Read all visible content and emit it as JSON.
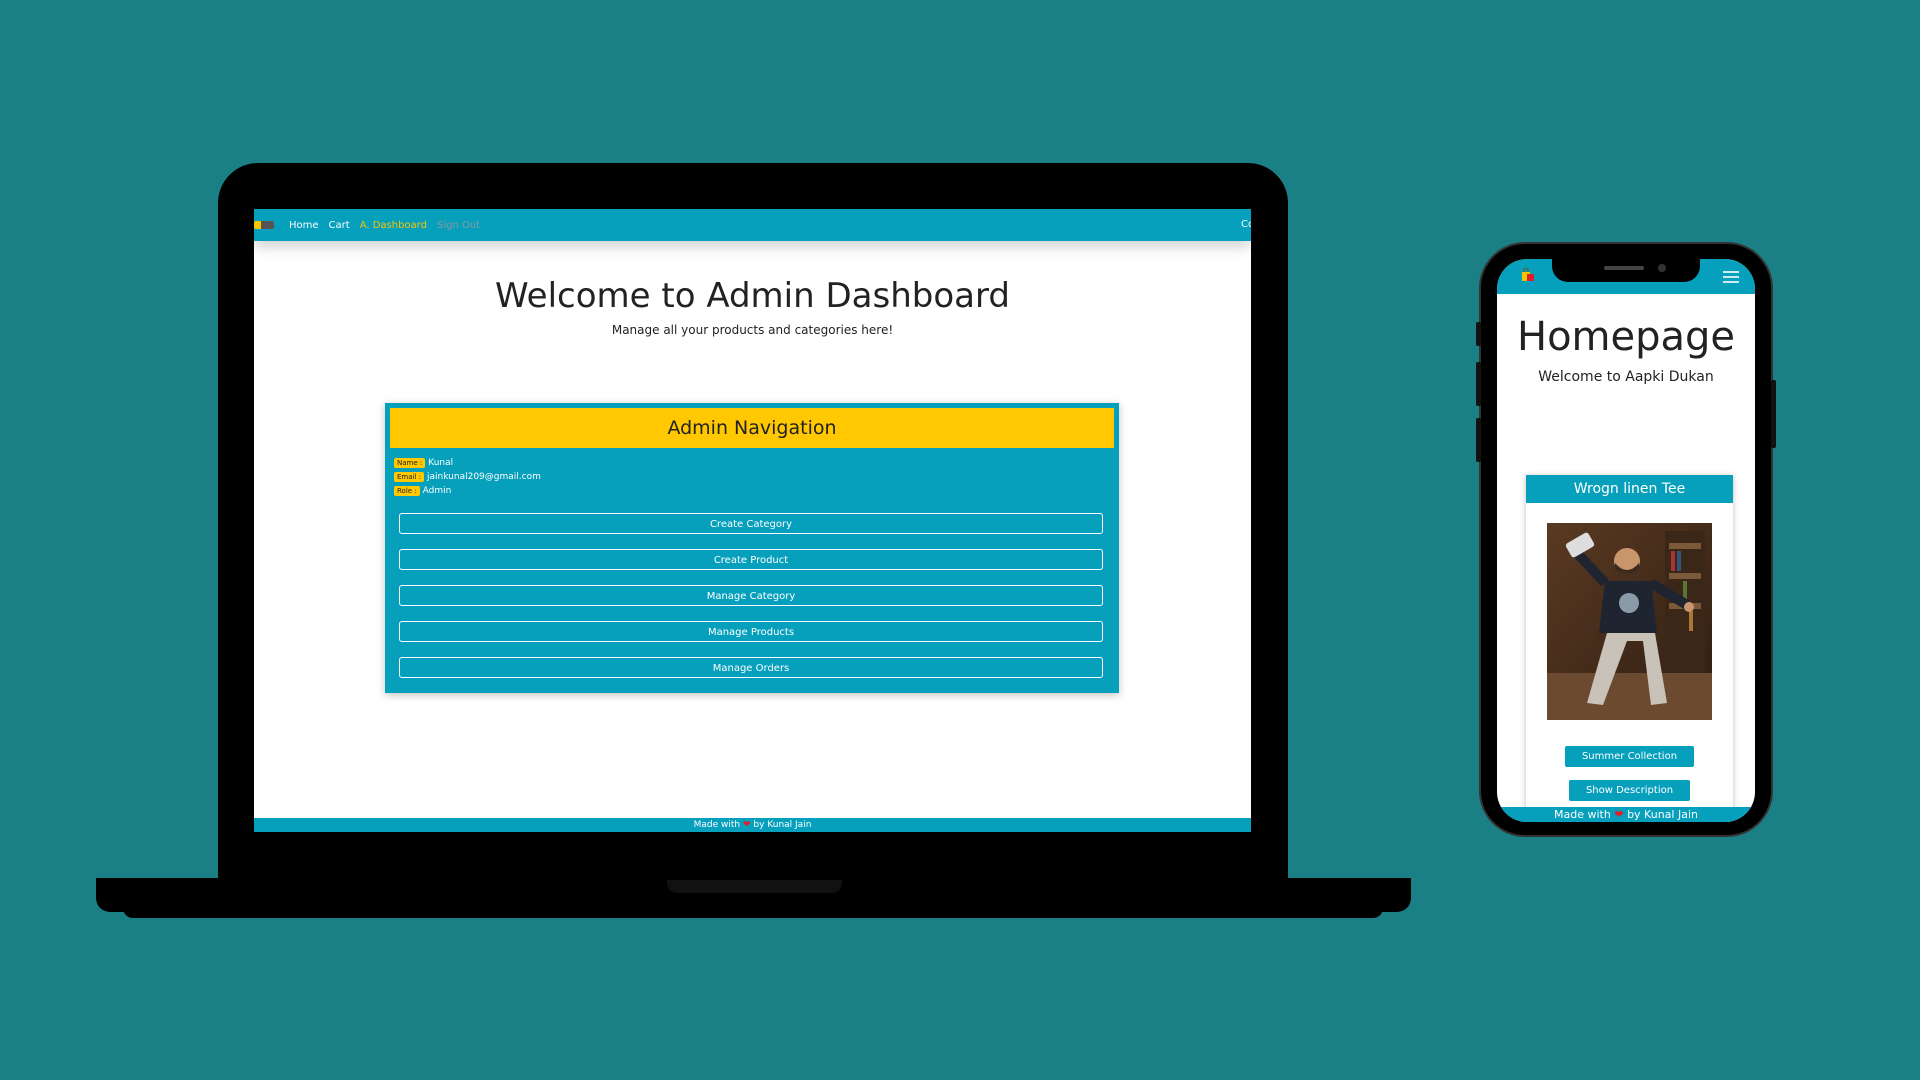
{
  "laptop": {
    "nav": {
      "links": [
        "Home",
        "Cart",
        "A. Dashboard",
        "Sign Out"
      ],
      "right_text": "Co"
    },
    "title": "Welcome to Admin Dashboard",
    "subtitle": "Manage all your products and categories here!",
    "card": {
      "header": "Admin Navigation",
      "info": [
        {
          "label": "Name :",
          "value": "Kunal"
        },
        {
          "label": "Email :",
          "value": "jainkunal209@gmail.com"
        },
        {
          "label": "Role :",
          "value": "Admin"
        }
      ],
      "buttons": [
        "Create Category",
        "Create Product",
        "Manage Category",
        "Manage Products",
        "Manage Orders"
      ]
    },
    "footer": {
      "before": "Made with",
      "heart": "❤",
      "after": "by Kunal Jain"
    }
  },
  "phone": {
    "title": "Homepage",
    "subtitle": "Welcome to Aapki Dukan",
    "product": {
      "name": "Wrogn linen Tee",
      "buttons": [
        "Summer Collection",
        "Show Description"
      ]
    },
    "footer": {
      "before": "Made with",
      "heart": "❤",
      "after": "by Kunal Jain"
    }
  },
  "colors": {
    "background": "#1b8085",
    "primary": "#06a0bd",
    "accent": "#ffc800"
  }
}
